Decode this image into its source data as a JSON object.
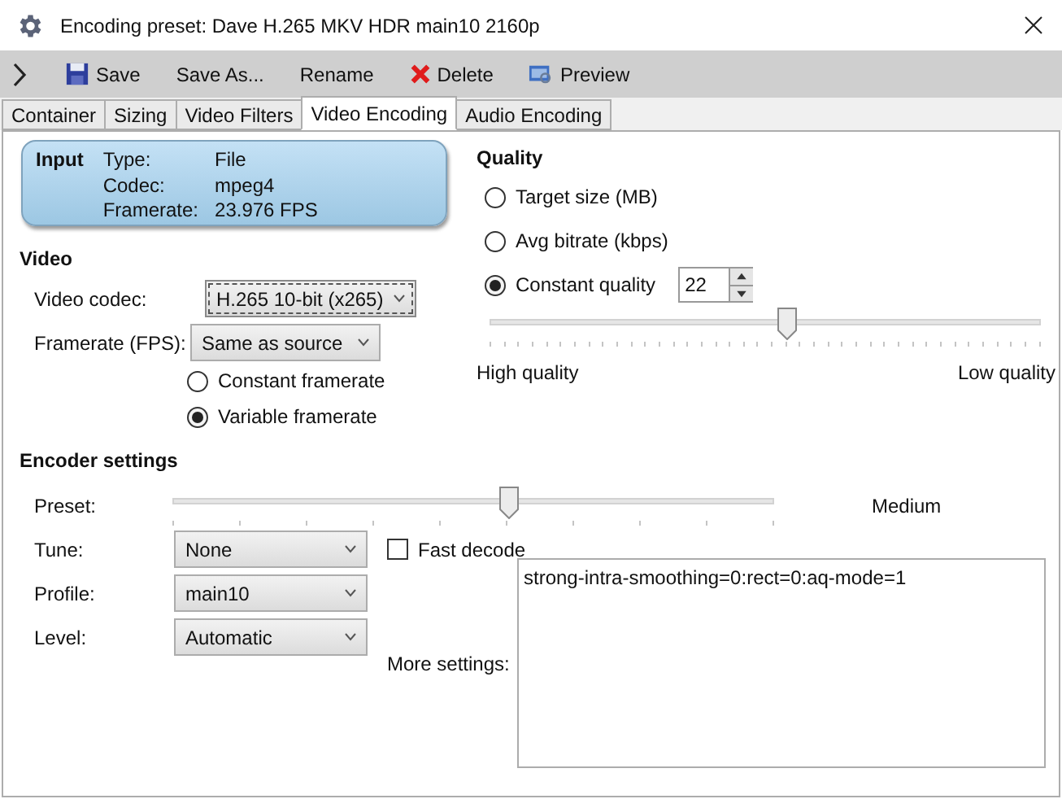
{
  "window": {
    "title": "Encoding preset: Dave H.265 MKV HDR main10 2160p"
  },
  "toolbar": [
    "Save",
    "Save As...",
    "Rename",
    "Delete",
    "Preview"
  ],
  "tabs": [
    {
      "label": "Container",
      "selected": false
    },
    {
      "label": "Sizing",
      "selected": false
    },
    {
      "label": "Video Filters",
      "selected": false
    },
    {
      "label": "Video Encoding",
      "selected": true
    },
    {
      "label": "Audio Encoding",
      "selected": false
    }
  ],
  "input": {
    "heading": "Input",
    "rows": [
      {
        "label": "Type:",
        "value": "File"
      },
      {
        "label": "Codec:",
        "value": "mpeg4"
      },
      {
        "label": "Framerate:",
        "value": "23.976 FPS"
      }
    ]
  },
  "video": {
    "heading": "Video",
    "codec": {
      "label": "Video codec:",
      "value": "H.265 10-bit (x265)",
      "focused": true
    },
    "framerate": {
      "label": "Framerate (FPS):",
      "value": "Same as source",
      "focused": false
    },
    "framerate_modes": [
      {
        "label": "Constant framerate",
        "selected": false
      },
      {
        "label": "Variable framerate",
        "selected": true
      }
    ]
  },
  "quality": {
    "heading": "Quality",
    "options": [
      {
        "label": "Target size (MB)",
        "selected": false
      },
      {
        "label": "Avg bitrate (kbps)",
        "selected": false
      },
      {
        "label": "Constant quality",
        "selected": true
      }
    ],
    "cq_value": "22",
    "slider": {
      "level": 0.54
    },
    "high_label": "High quality",
    "low_label": "Low quality"
  },
  "encoder": {
    "heading": "Encoder settings",
    "preset": {
      "label": "Preset:",
      "level": 0.56,
      "value": "Medium"
    },
    "fields": [
      {
        "label": "Tune:",
        "value": "None"
      },
      {
        "label": "Profile:",
        "value": "main10"
      },
      {
        "label": "Level:",
        "value": "Automatic"
      }
    ],
    "fast_decode": {
      "label": "Fast decode",
      "checked": false
    },
    "more_settings": {
      "label": "More settings:",
      "value": "strong-intra-smoothing=0:rect=0:aq-mode=1"
    }
  }
}
